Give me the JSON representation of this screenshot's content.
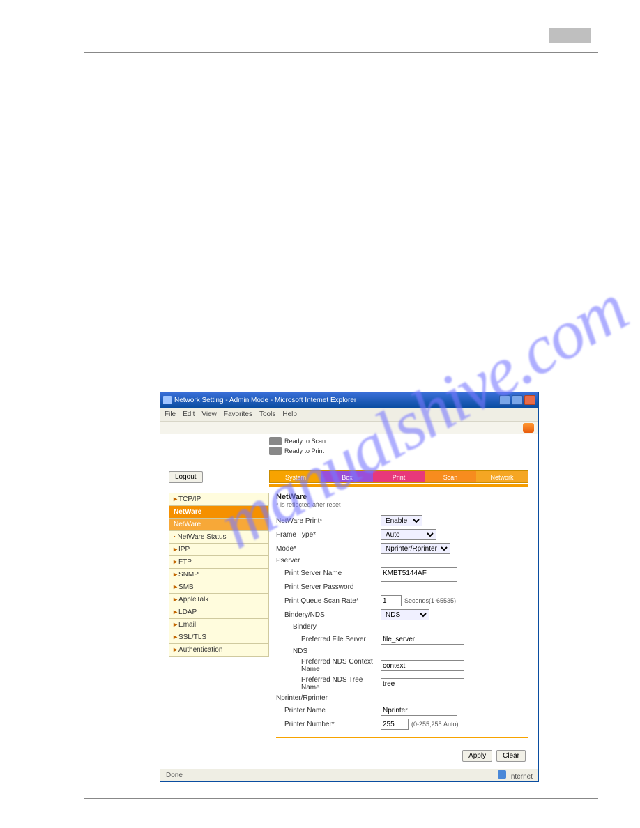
{
  "window": {
    "title": "Network Setting - Admin Mode - Microsoft Internet Explorer",
    "menus": [
      "File",
      "Edit",
      "View",
      "Favorites",
      "Tools",
      "Help"
    ]
  },
  "status_icons": {
    "ready_scan": "Ready to Scan",
    "ready_print": "Ready to Print"
  },
  "logout_label": "Logout",
  "tabs": {
    "t1": "System",
    "t2": "Box",
    "t3": "Print",
    "t4": "Scan",
    "t5": "Network"
  },
  "sidebar": {
    "items": [
      {
        "label": "TCP/IP",
        "cls": ""
      },
      {
        "label": "NetWare",
        "cls": "active1"
      },
      {
        "label": "NetWare",
        "cls": "active2"
      },
      {
        "label": "NetWare Status",
        "cls": ""
      },
      {
        "label": "IPP",
        "cls": ""
      },
      {
        "label": "FTP",
        "cls": ""
      },
      {
        "label": "SNMP",
        "cls": ""
      },
      {
        "label": "SMB",
        "cls": ""
      },
      {
        "label": "AppleTalk",
        "cls": ""
      },
      {
        "label": "LDAP",
        "cls": ""
      },
      {
        "label": "Email",
        "cls": ""
      },
      {
        "label": "SSL/TLS",
        "cls": ""
      },
      {
        "label": "Authentication",
        "cls": ""
      }
    ]
  },
  "main": {
    "title": "NetWare",
    "hint": "* is reflected after reset",
    "netware_print_label": "NetWare Print*",
    "netware_print_value": "Enable",
    "frame_type_label": "Frame Type*",
    "frame_type_value": "Auto",
    "mode_label": "Mode*",
    "mode_value": "Nprinter/Rprinter",
    "pserver_label": "Pserver",
    "print_server_name_label": "Print Server Name",
    "print_server_name_value": "KMBT5144AF",
    "print_server_password_label": "Print Server Password",
    "print_server_password_value": "",
    "print_queue_scan_rate_label": "Print Queue Scan Rate*",
    "print_queue_scan_rate_value": "1",
    "print_queue_scan_rate_suffix": "Seconds(1-65535)",
    "bindery_nds_label": "Bindery/NDS",
    "bindery_nds_value": "NDS",
    "bindery_label": "Bindery",
    "preferred_file_server_label": "Preferred File Server",
    "preferred_file_server_value": "file_server",
    "nds_label": "NDS",
    "preferred_nds_context_label": "Preferred NDS Context Name",
    "preferred_nds_context_value": "context",
    "preferred_nds_tree_label": "Preferred NDS Tree Name",
    "preferred_nds_tree_value": "tree",
    "nprinter_rprinter_label": "Nprinter/Rprinter",
    "printer_name_label": "Printer Name",
    "printer_name_value": "Nprinter",
    "printer_number_label": "Printer Number*",
    "printer_number_value": "255",
    "printer_number_suffix": "(0-255,255:Auto)"
  },
  "actions": {
    "apply": "Apply",
    "clear": "Clear"
  },
  "statusbar": {
    "left": "Done",
    "right": "Internet"
  },
  "watermark": "manualshive.com"
}
